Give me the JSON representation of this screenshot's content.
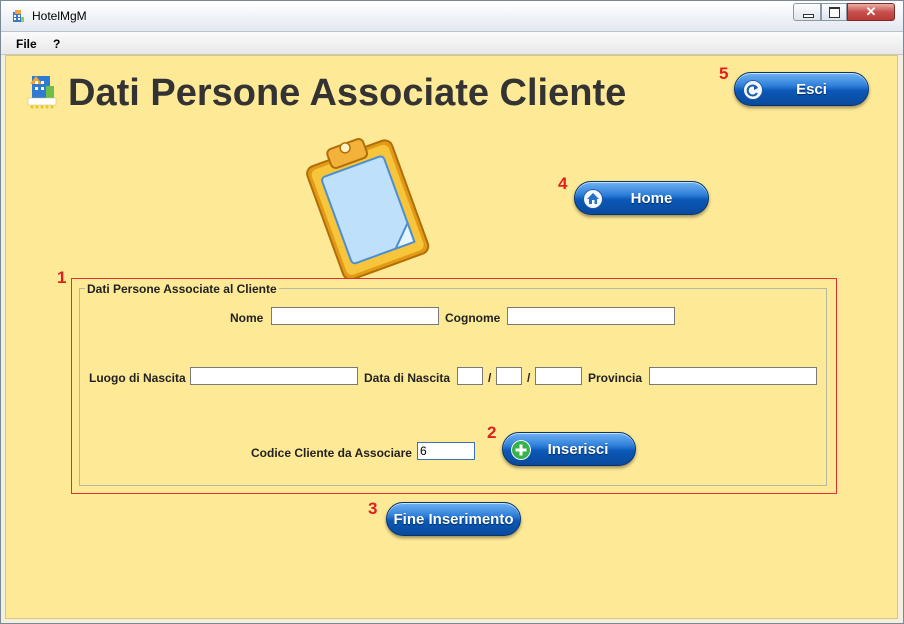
{
  "window": {
    "title": "HotelMgM"
  },
  "menubar": {
    "items": [
      "File",
      "?"
    ]
  },
  "header": {
    "title": "Dati Persone Associate Cliente"
  },
  "buttons": {
    "esci": "Esci",
    "home": "Home",
    "inserisci": "Inserisci",
    "fine_inserimento": "Fine Inserimento"
  },
  "form": {
    "legend": "Dati Persone Associate al Cliente",
    "nome_label": "Nome",
    "nome_value": "",
    "cognome_label": "Cognome",
    "cognome_value": "",
    "luogo_nascita_label": "Luogo di Nascita",
    "luogo_nascita_value": "",
    "data_nascita_label": "Data di Nascita",
    "data_separator": "/",
    "data_giorno_value": "",
    "data_mese_value": "",
    "data_anno_value": "",
    "provincia_label": "Provincia",
    "provincia_value": "",
    "codice_cliente_label": "Codice Cliente da Associare",
    "codice_cliente_value": "6"
  },
  "annotations": [
    "1",
    "2",
    "3",
    "4",
    "5"
  ],
  "icons": {
    "app": "hotel-app-icon",
    "logo": "hotel-logo-icon",
    "clipboard": "clipboard-icon",
    "esci": "exit-arrow-icon",
    "home": "home-icon",
    "inserisci": "plus-icon"
  },
  "colors": {
    "background": "#fee996",
    "button_blue": "#0b58b8",
    "highlight_red": "#e03030",
    "title_text": "#333333"
  }
}
